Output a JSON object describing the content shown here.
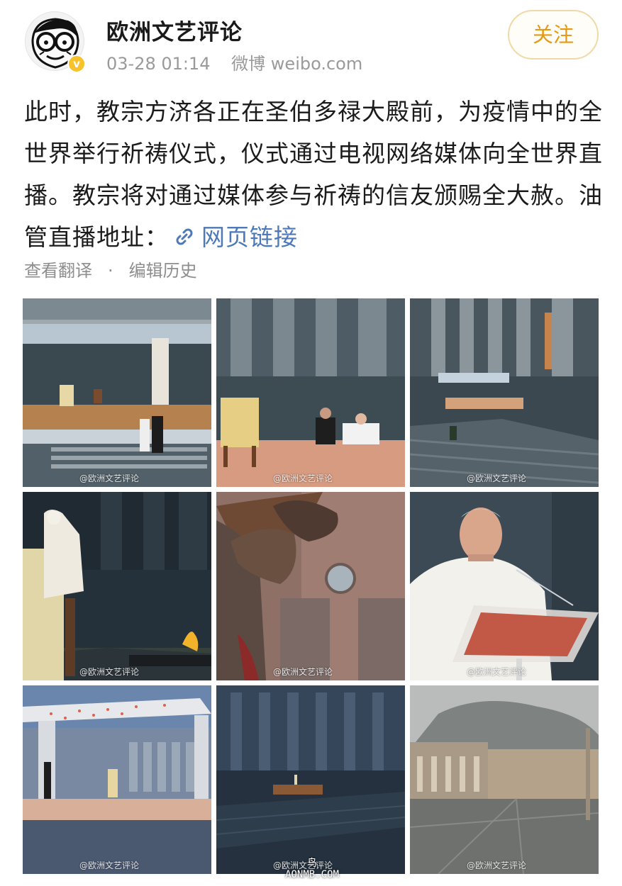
{
  "header": {
    "username": "欧洲文艺评论",
    "timestamp": "03-28 01:14",
    "source": "微博 weibo.com",
    "follow_label": "关注",
    "avatar_icon": "cartoon-avatar-icon",
    "verified_icon": "verified-badge-icon",
    "verified_glyph": "v"
  },
  "post": {
    "text": "此时，教宗方济各正在圣伯多禄大殿前，为疫情中的全世界举行祈祷仪式，仪式通过电视网络媒体向全世界直播。教宗将对通过媒体参与祈祷的信友颁赐全大赦。油管直播地址：",
    "link_label": "网页链接",
    "link_icon": "link-icon"
  },
  "actions": {
    "translate": "查看翻译",
    "separator": "·",
    "history": "编辑历史"
  },
  "images": {
    "watermark": "@欧洲文艺评论",
    "items": [
      {
        "id": 1,
        "scene": "pope-at-outdoor-platform-rain"
      },
      {
        "id": 2,
        "scene": "pope-seated-with-aide-empty-chair"
      },
      {
        "id": 3,
        "scene": "empty-square-with-canopy"
      },
      {
        "id": 4,
        "scene": "pope-standing-back-view-rain"
      },
      {
        "id": 5,
        "scene": "crucifix-close-up"
      },
      {
        "id": 6,
        "scene": "pope-speaking-at-lectern"
      },
      {
        "id": 7,
        "scene": "canopy-at-dusk"
      },
      {
        "id": 8,
        "scene": "basilica-night-lit-platform"
      },
      {
        "id": 9,
        "scene": "square-under-cloudy-sky"
      }
    ]
  },
  "site_watermark": {
    "line1": "鸟",
    "line2": "AONMB.COM"
  },
  "colors": {
    "follow_text": "#e59a14",
    "follow_border": "#f0d9a7",
    "link": "#4d79b8",
    "meta": "#9a9a9a"
  }
}
